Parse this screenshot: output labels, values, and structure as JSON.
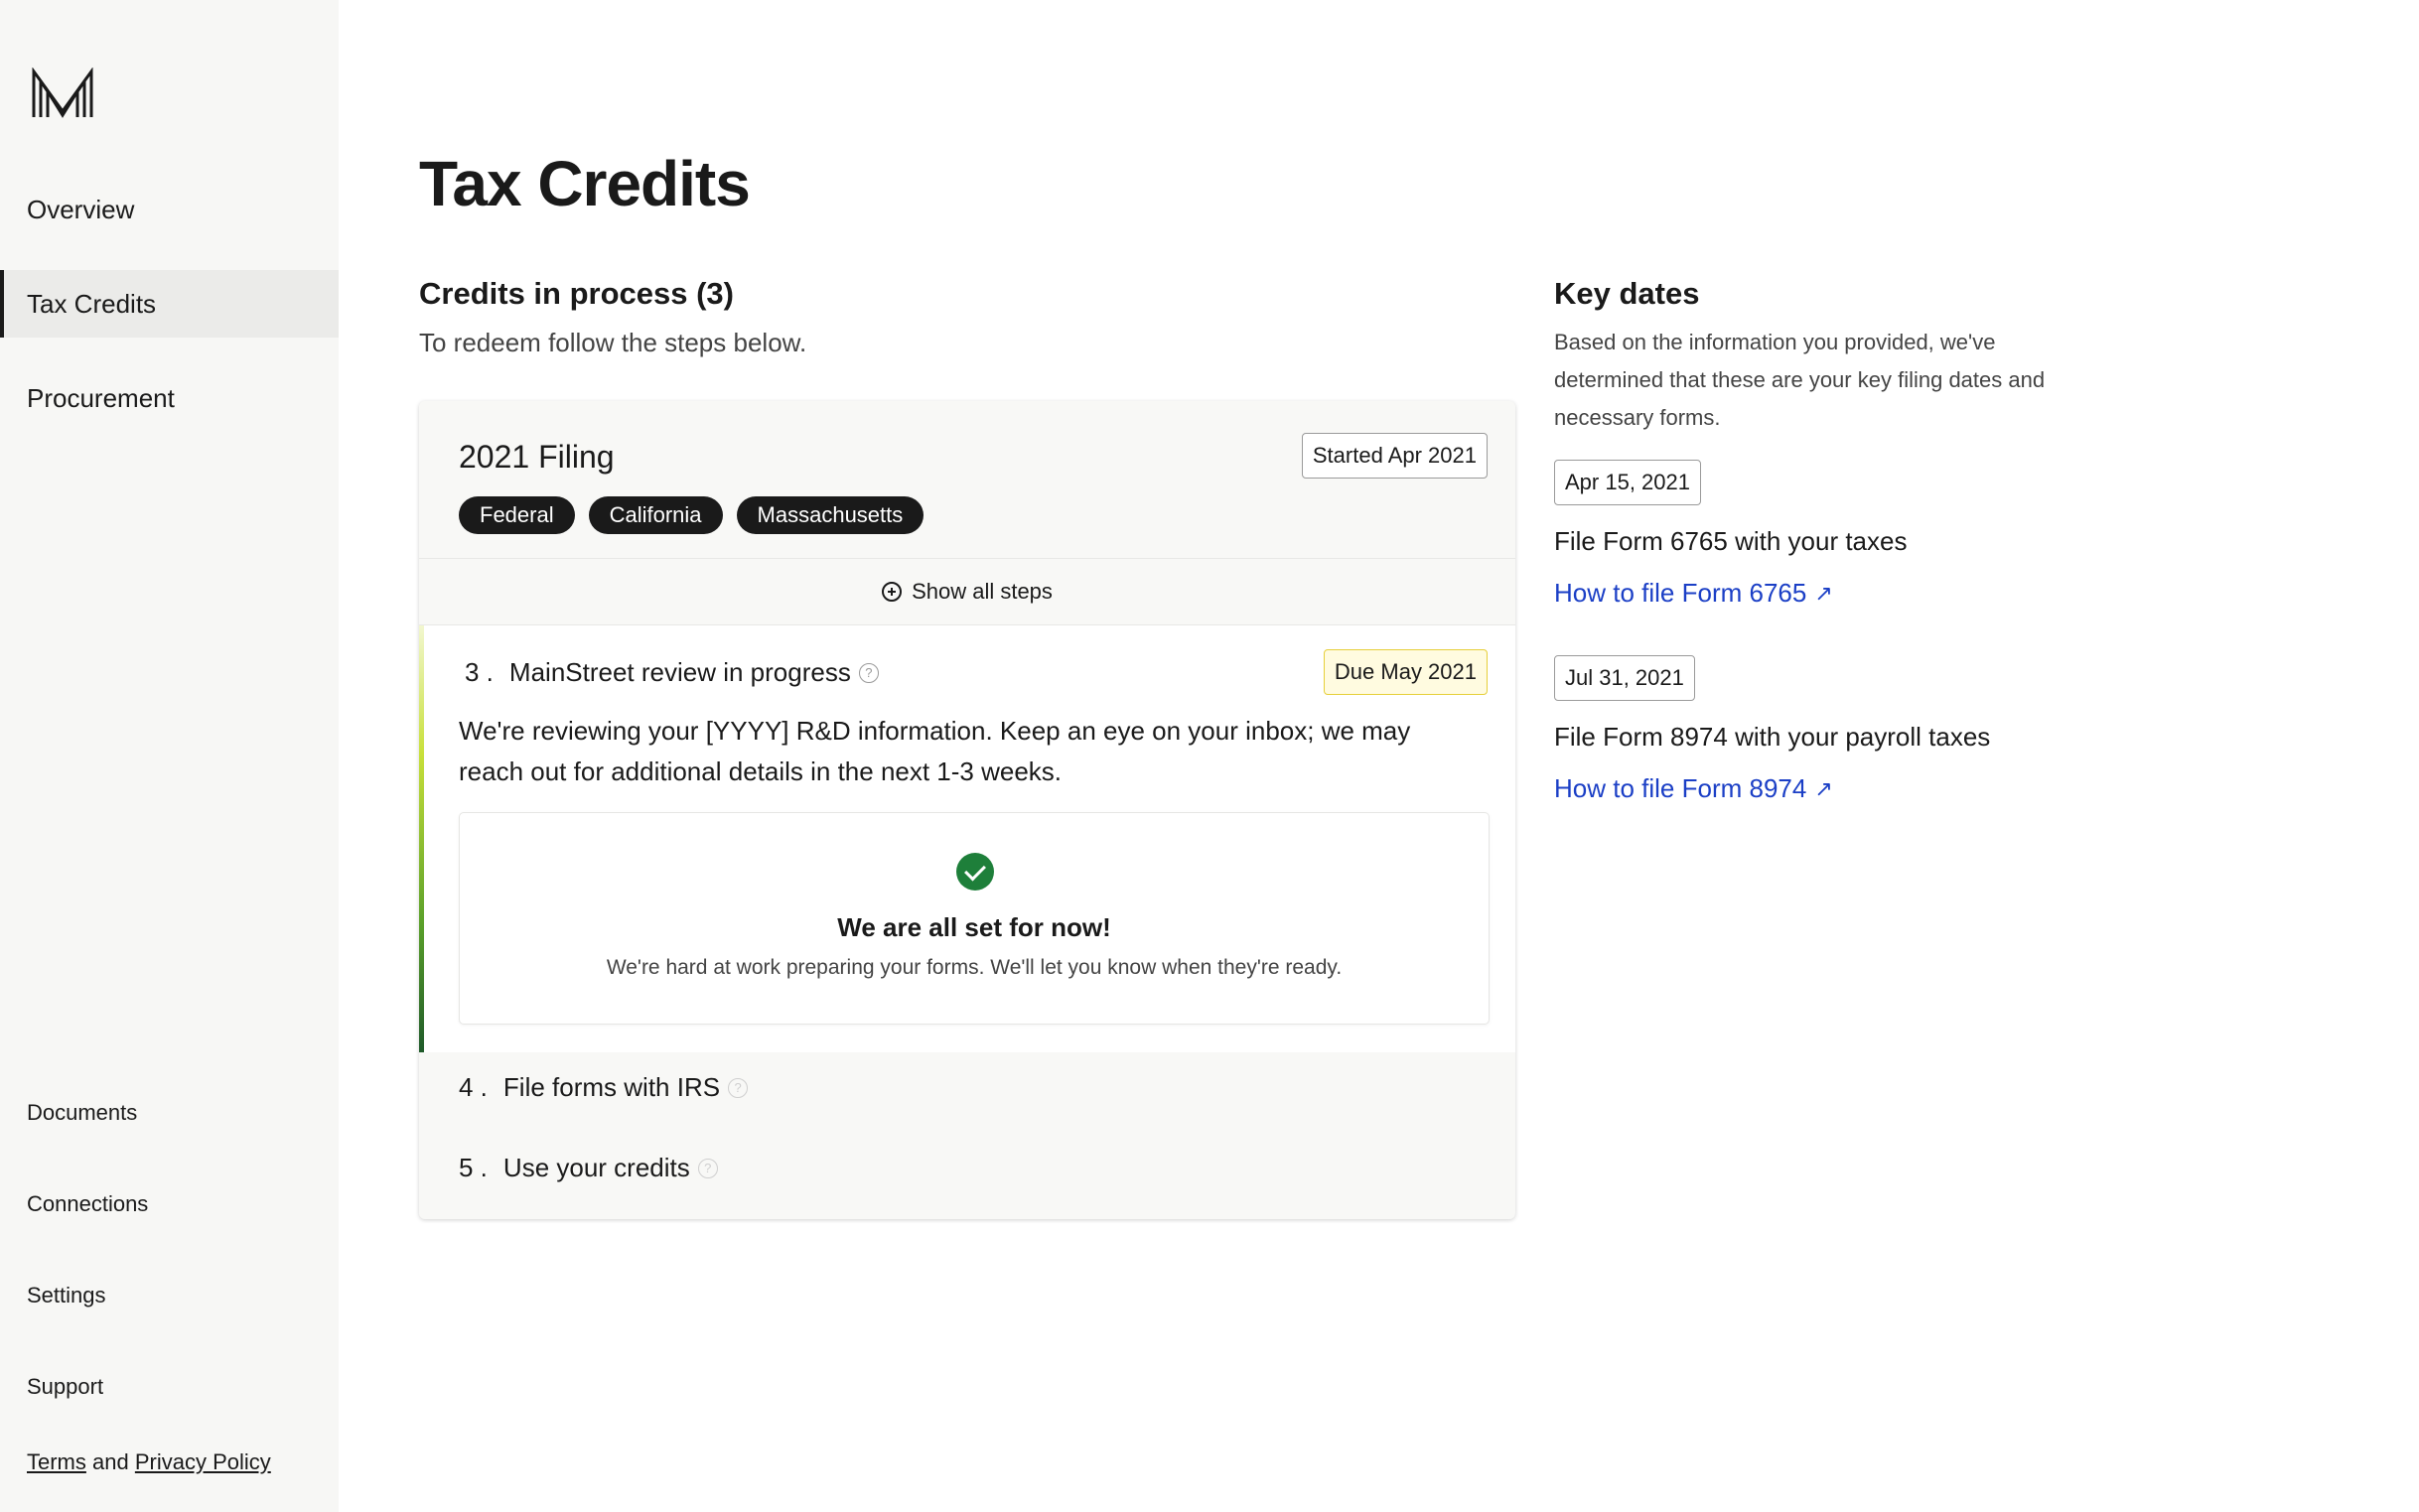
{
  "sidebar": {
    "nav": [
      {
        "label": "Overview",
        "active": false
      },
      {
        "label": "Tax Credits",
        "active": true
      },
      {
        "label": "Procurement",
        "active": false
      }
    ],
    "bottom": [
      "Documents",
      "Connections",
      "Settings",
      "Support"
    ],
    "legal": {
      "terms": "Terms",
      "and": "and",
      "privacy": "Privacy Policy"
    }
  },
  "page": {
    "title": "Tax Credits",
    "section_title": "Credits in process (3)",
    "section_sub": "To redeem follow the steps below."
  },
  "card": {
    "title": "2021 Filing",
    "started": "Started Apr 2021",
    "chips": [
      "Federal",
      "California",
      "Massachusetts"
    ],
    "show_steps": "Show all steps",
    "active_step": {
      "num": "3 .",
      "label": "MainStreet review in progress",
      "due": "Due May 2021",
      "desc": "We're reviewing your [YYYY] R&D information. Keep an eye on your inbox; we may reach out for additional details in the next 1-3 weeks.",
      "done_title": "We are all set for now!",
      "done_sub": "We're hard at work preparing your forms. We'll let you know when they're ready."
    },
    "steps": [
      {
        "num": "4 .",
        "label": "File forms with IRS"
      },
      {
        "num": "5 .",
        "label": "Use your credits"
      }
    ]
  },
  "key_dates": {
    "title": "Key dates",
    "desc": "Based on the information you provided, we've determined that these are your key filing dates and necessary forms.",
    "items": [
      {
        "date": "Apr 15, 2021",
        "text": "File Form 6765 with your taxes",
        "link": "How to file Form 6765"
      },
      {
        "date": "Jul 31, 2021",
        "text": "File Form 8974 with your payroll taxes",
        "link": "How to file Form 8974"
      }
    ],
    "link_color": "#1b3fc6"
  },
  "colors": {
    "accent_dark": "#1a1a1a",
    "success": "#1e7f3a",
    "due_border": "#e6cf3a"
  }
}
